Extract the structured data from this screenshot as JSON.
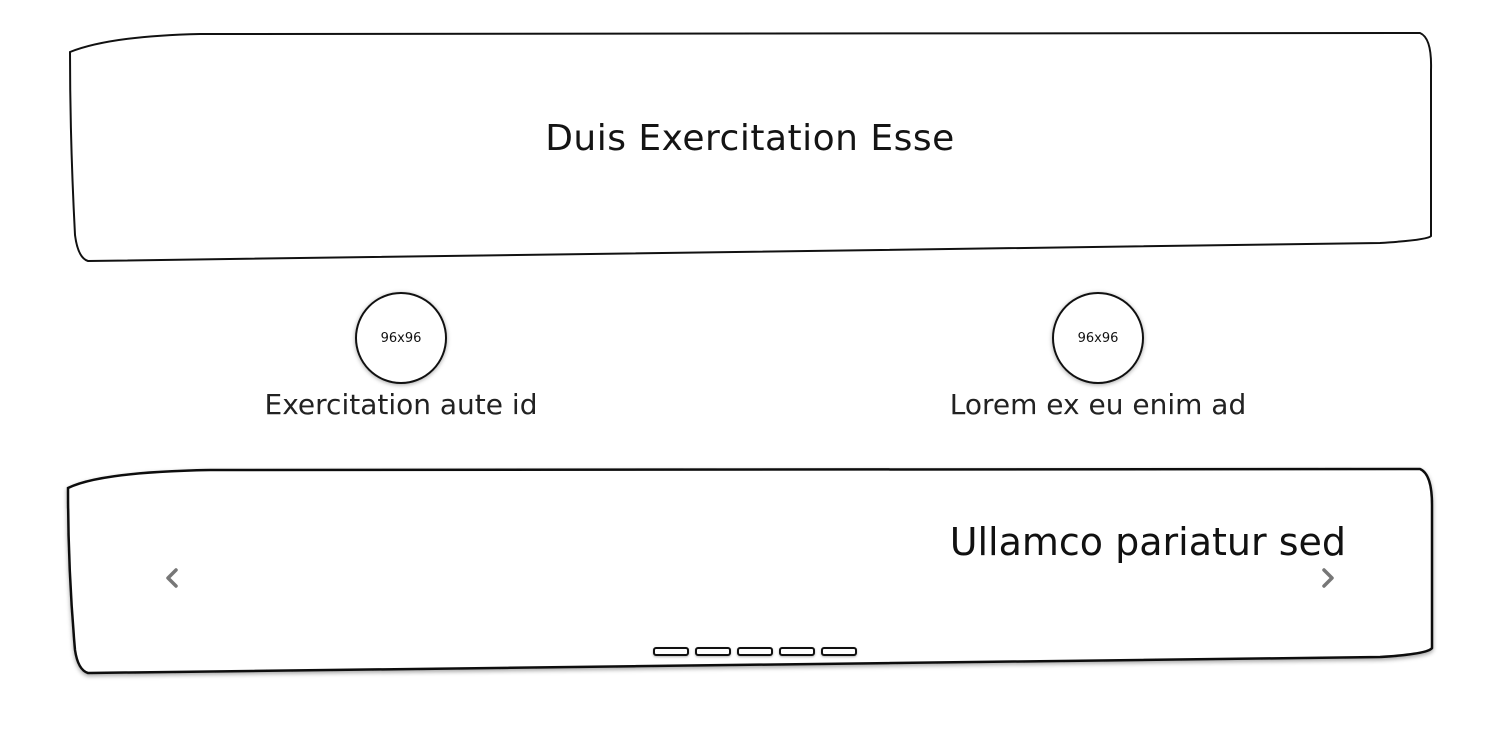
{
  "hero": {
    "title": "Duis Exercitation Esse"
  },
  "profiles": [
    {
      "avatar_label": "96x96",
      "caption": "Exercitation aute id"
    },
    {
      "avatar_label": "96x96",
      "caption": "Lorem ex eu enim ad"
    }
  ],
  "carousel": {
    "slide_text": "Ullamco pariatur sed",
    "prev_icon": "chevron-left-icon",
    "next_icon": "chevron-right-icon",
    "indicator_count": 5,
    "chevron_color": "#777777"
  }
}
